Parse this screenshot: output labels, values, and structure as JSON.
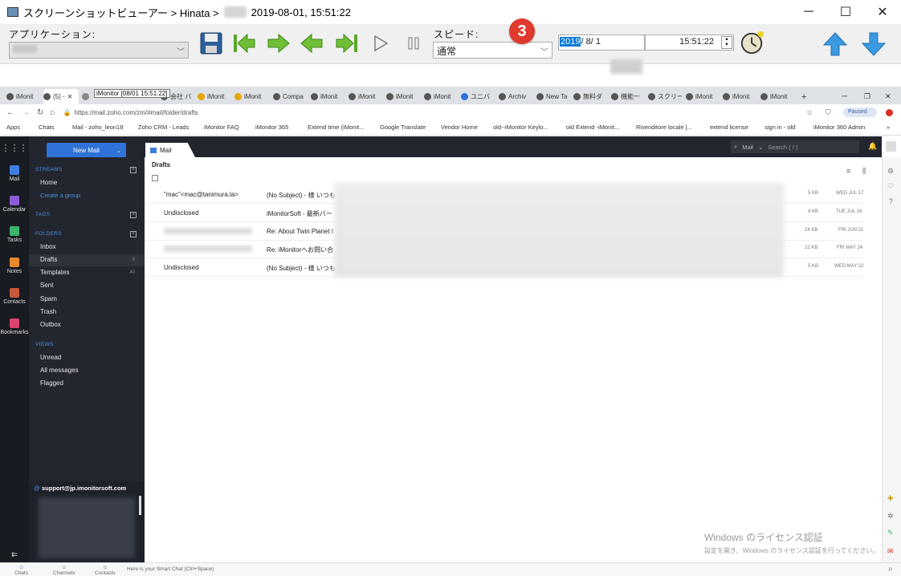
{
  "window": {
    "title_prefix": "スクリーンショットビューアー > Hinata >",
    "title_date": "2019-08-01, 15:51:22",
    "minimize_glyph": "─",
    "maximize_glyph": "☐",
    "close_glyph": "✕"
  },
  "toolbar": {
    "app_label": "アプリケーション:",
    "speed_label": "スピード:",
    "speed_value": "通常",
    "badge_number": "3",
    "date_year": "2019",
    "date_rest": "/ 8/ 1",
    "time_value": "15:51:22",
    "icons": [
      "save-icon",
      "first-icon",
      "next-icon",
      "prev-icon",
      "last-icon",
      "play-icon",
      "pause-icon",
      "clock-icon",
      "up-arrow-icon",
      "down-arrow-icon"
    ]
  },
  "browser": {
    "tabs": [
      {
        "label": "iMonit"
      },
      {
        "label": "(5) -"
      },
      {
        "label": "iMonitor [08/01 15:51:22]"
      },
      {
        "label": "会社 バ"
      },
      {
        "label": "iMonit"
      },
      {
        "label": "iMonit"
      },
      {
        "label": "Compa"
      },
      {
        "label": "iMonit"
      },
      {
        "label": "iMonit"
      },
      {
        "label": "iMonit"
      },
      {
        "label": "iMonit"
      },
      {
        "label": "ユニバ"
      },
      {
        "label": "Archiv"
      },
      {
        "label": "New Ta"
      },
      {
        "label": "無料ダ"
      },
      {
        "label": "機能一"
      },
      {
        "label": "スクリー"
      },
      {
        "label": "iMonit"
      },
      {
        "label": "iMonit"
      },
      {
        "label": "iMonit"
      }
    ],
    "tooltip": "iMonitor [08/01 15:51:22]",
    "url": "https://mail.zoho.com/zm/#mail/folder/drafts",
    "paused_label": "Paused",
    "bookmarks": [
      "Apps",
      "Chats",
      "Mail - zoho_leon18",
      "Zoho CRM - Leads",
      "iMonitor FAQ",
      "iMonitor 365",
      "Extend time (iMonit...",
      "Google Translate",
      "Vendor Home",
      "old--iMonitor Keylo...",
      "old Extend -iMonit...",
      "Rivenditore locale |...",
      "extend license",
      "sign in - old",
      "iMonitor 360 Admin"
    ]
  },
  "zoho": {
    "new_mail": "New Mail",
    "mail_tab": "Mail",
    "search_scope": "Mail",
    "search_placeholder": "Search ( / )",
    "rail": [
      "Mail",
      "Calendar",
      "Tasks",
      "Notes",
      "Contacts",
      "Bookmarks"
    ],
    "sections": {
      "streams": "STREAMS",
      "home": "Home",
      "create_group": "Create a group",
      "tags": "TAGS",
      "folders": "FOLDERS",
      "views": "VIEWS"
    },
    "folders": [
      {
        "name": "Inbox",
        "count": ""
      },
      {
        "name": "Drafts",
        "count": "5"
      },
      {
        "name": "Templates",
        "count": "40"
      },
      {
        "name": "Sent",
        "count": ""
      },
      {
        "name": "Spam",
        "count": ""
      },
      {
        "name": "Trash",
        "count": ""
      },
      {
        "name": "Outbox",
        "count": ""
      }
    ],
    "views": [
      "Unread",
      "All messages",
      "Flagged"
    ],
    "folder_title": "Drafts",
    "mails": [
      {
        "from": "\"mac\"<mac@tanimura.la>",
        "subject": "(No Subject) - 様 いつも",
        "size": "5 KB",
        "date": "WED JUL 17"
      },
      {
        "from": "Undisclosed",
        "subject": "iMonitorSoft - 最新バー",
        "size": "4 KB",
        "date": "TUE JUL 16"
      },
      {
        "from": "",
        "subject": "Re: About Twin Planet I",
        "size": "24 KB",
        "date": "FRI JUN 21"
      },
      {
        "from": "",
        "subject": "Re: iMonitorへお問い合",
        "size": "22 KB",
        "date": "FRI MAY 24"
      },
      {
        "from": "Undisclosed",
        "subject": "(No Subject) - 様 いつも",
        "size": "5 KB",
        "date": "WED MAY 22"
      }
    ],
    "account": "support@jp.imonitorsoft.com",
    "bottom": {
      "chats": "Chats",
      "channels": "Channels",
      "contacts": "Contacts",
      "smartchat": "Here is your Smart Chat (Ctrl+Space)"
    },
    "watermark_title": "Windows のライセンス認証",
    "watermark_sub": "設定を開き、Windows のライセンス認証を行ってください。"
  }
}
